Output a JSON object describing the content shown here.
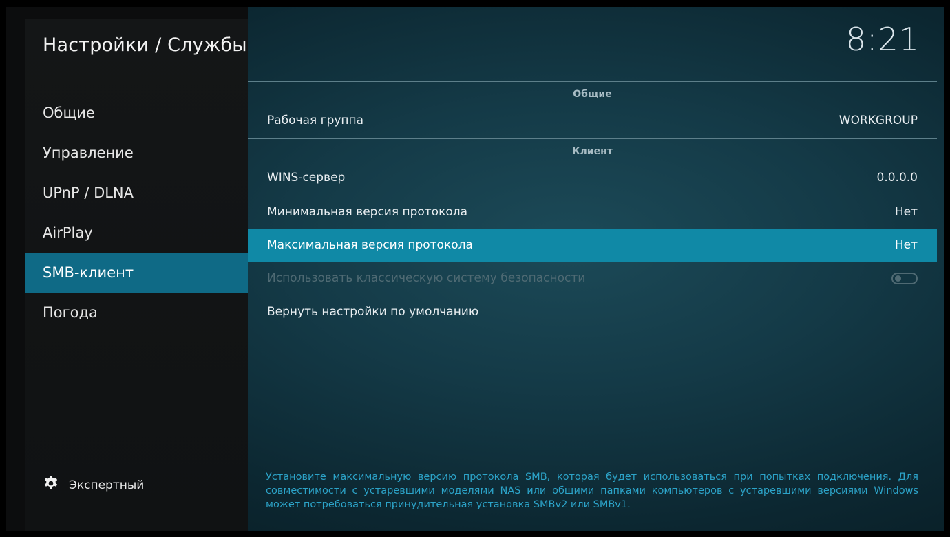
{
  "header": {
    "title": "Настройки / Службы",
    "clock": "8:21"
  },
  "sidebar": {
    "items": [
      {
        "label": "Общие"
      },
      {
        "label": "Управление"
      },
      {
        "label": "UPnP / DLNA"
      },
      {
        "label": "AirPlay"
      },
      {
        "label": "SMB-клиент",
        "active": true
      },
      {
        "label": "Погода"
      }
    ],
    "expert_label": "Экспертный"
  },
  "settings": {
    "group_general": "Общие",
    "workgroup": {
      "label": "Рабочая группа",
      "value": "WORKGROUP"
    },
    "group_client": "Клиент",
    "wins": {
      "label": "WINS-сервер",
      "value": "0.0.0.0"
    },
    "min_proto": {
      "label": "Минимальная версия протокола",
      "value": "Нет"
    },
    "max_proto": {
      "label": "Максимальная версия протокола",
      "value": "Нет"
    },
    "legacy_security": {
      "label": "Использовать классическую систему безопасности",
      "enabled": false
    },
    "reset": {
      "label": "Вернуть настройки по умолчанию"
    }
  },
  "description": "Установите максимальную версию протокола SMB, которая будет использоваться при попытках подключения. Для совместимости с устаревшими моделями NAS или общими папками компьютеров с устаревшими версиями Windows может потребоваться принудительная установка SMBv2 или SMBv1.",
  "colors": {
    "accent": "#1089a6",
    "sidebar_active": "#0f6a86",
    "description": "#2ca3c8"
  },
  "icons": {
    "expert": "gear-icon"
  }
}
